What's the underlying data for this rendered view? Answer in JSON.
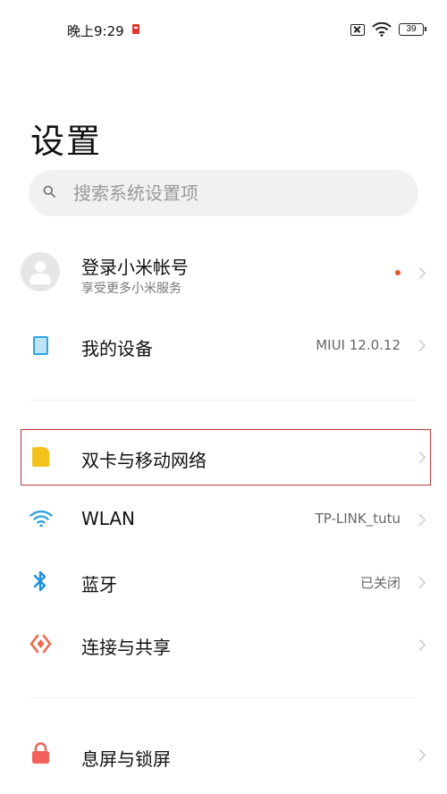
{
  "status_bar": {
    "time": "晚上9:29",
    "battery": "39"
  },
  "page": {
    "title": "设置"
  },
  "search": {
    "placeholder": "搜索系统设置项"
  },
  "account": {
    "title": "登录小米帐号",
    "subtitle": "享受更多小米服务"
  },
  "settings": [
    {
      "label": "我的设备",
      "value": "MIUI 12.0.12",
      "icon": "tablet-icon"
    },
    {
      "label": "双卡与移动网络",
      "value": "",
      "icon": "sim-card-icon"
    },
    {
      "label": "WLAN",
      "value": "TP-LINK_tutu",
      "icon": "wifi-icon"
    },
    {
      "label": "蓝牙",
      "value": "已关闭",
      "icon": "bluetooth-icon"
    },
    {
      "label": "连接与共享",
      "value": "",
      "icon": "connection-share-icon"
    },
    {
      "label": "息屏与锁屏",
      "value": "",
      "icon": "lock-icon"
    }
  ],
  "colors": {
    "notification_dot": "#e15a2a",
    "highlight_border": "#b33a3a",
    "wifi": "#2ea4e0",
    "bluetooth": "#1f8fe0",
    "connect": "#f06a4a",
    "lock": "#f0625a",
    "sim": "#f4c21d"
  }
}
